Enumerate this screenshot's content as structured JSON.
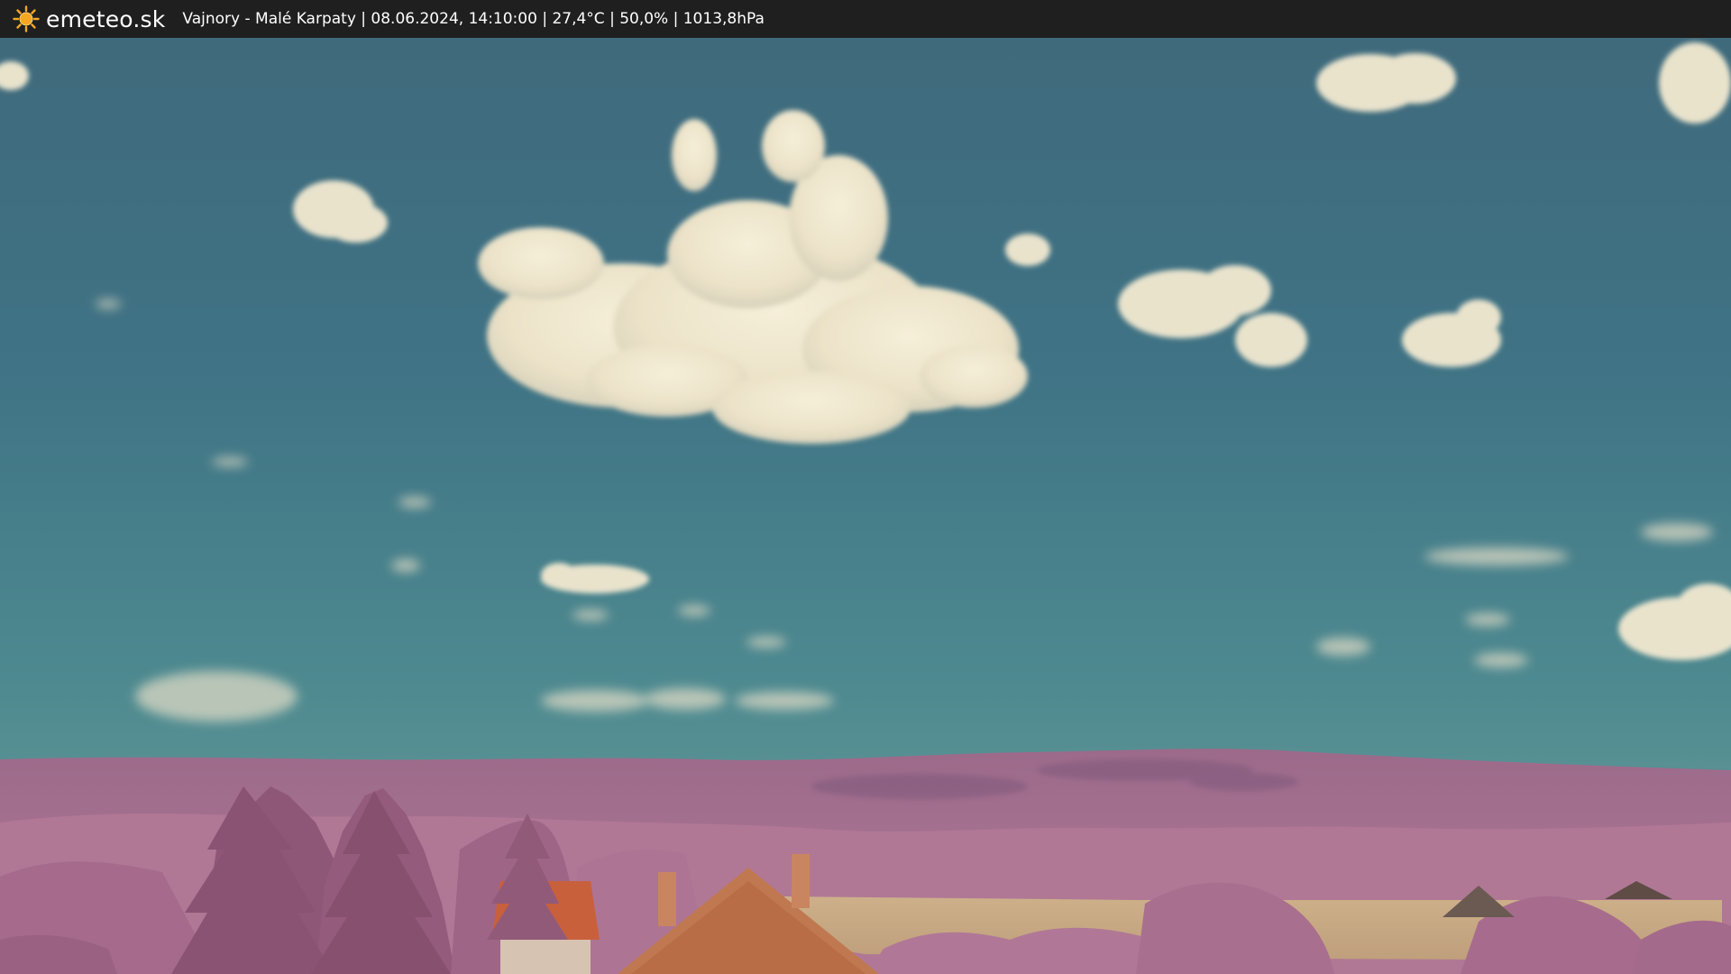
{
  "header": {
    "brand": "emeteo.sk",
    "caption": "Vajnory - Malé Karpaty | 08.06.2024, 14:10:00 | 27,4°C | 50,0% | 1013,8hPa",
    "logo_icon": "sun-icon"
  },
  "colors": {
    "bar": "#1f1f1f",
    "sun": "#f5a623",
    "sky_top": "#3d6b7e",
    "sky_bottom": "#6b9a9a",
    "vegetation": "#a86e94",
    "field": "#c9a982",
    "roof": "#c8603c"
  }
}
